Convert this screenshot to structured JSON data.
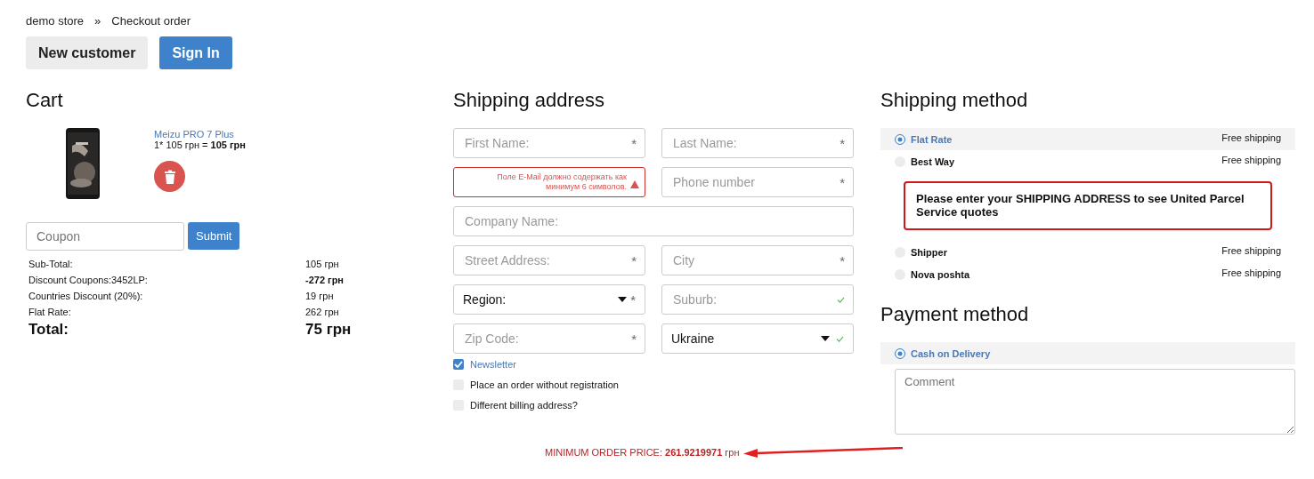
{
  "breadcrumb": [
    {
      "label": "demo store"
    },
    {
      "label": "Checkout order"
    }
  ],
  "breadcrumb_separator": "»",
  "account_buttons": [
    {
      "label": "New customer",
      "selected": true
    },
    {
      "label": "Sign In",
      "selected": false
    }
  ],
  "cart": {
    "title": "Cart",
    "items": [
      {
        "kind": "picture",
        "name": "Meizu PRO 7 Plus",
        "quantity_price": "1* 105 грн = ",
        "line_total": "105 грн"
      }
    ],
    "coupon": {
      "placeholder": "Coupon",
      "button": "Submit"
    },
    "totals": [
      {
        "label": "Sub-Total:",
        "value": "105 грн",
        "bold": false
      },
      {
        "label": "Discount Coupons:3452LP:",
        "value": "-272 грн",
        "bold": true
      },
      {
        "label": "Countries Discount (20%):",
        "value": "19 грн",
        "bold": false
      },
      {
        "label": "Flat Rate:",
        "value": "262 грн",
        "bold": false
      }
    ],
    "total": {
      "label": "Total:",
      "value": "75 грн"
    }
  },
  "shipping_address": {
    "title": "Shipping address",
    "fields": [
      {
        "kind": "input",
        "placeholder": "First Name:",
        "marker": "*",
        "wide": false,
        "valid": false
      },
      {
        "kind": "input",
        "placeholder": "Last Name:",
        "marker": "*",
        "wide": false,
        "valid": false
      },
      {
        "kind": "error",
        "message": "Поле E-Mail должно содержать как минимум 6 символов.",
        "wide": false,
        "valid": false
      },
      {
        "kind": "input",
        "placeholder": "Phone number",
        "marker": "*",
        "wide": false,
        "valid": false
      },
      {
        "kind": "input",
        "placeholder": "Company Name:",
        "wide": true,
        "valid": false
      },
      {
        "kind": "input",
        "placeholder": "Street Address:",
        "marker": "*",
        "wide": false,
        "valid": false
      },
      {
        "kind": "input",
        "placeholder": "City",
        "marker": "*",
        "wide": false,
        "valid": false
      },
      {
        "kind": "select",
        "value": "Region:",
        "marker": "*",
        "wide": false,
        "valid": false
      },
      {
        "kind": "input",
        "placeholder": "Suburb:",
        "wide": false,
        "valid": true
      },
      {
        "kind": "input",
        "placeholder": "Zip Code:",
        "marker": "*",
        "wide": false,
        "valid": false
      },
      {
        "kind": "select",
        "value": "Ukraine",
        "wide": false,
        "valid": true
      }
    ],
    "options": [
      {
        "label": "Newsletter",
        "checked": true
      },
      {
        "label": "Place an order without registration",
        "checked": false
      },
      {
        "label": "Different billing address?",
        "checked": false
      }
    ]
  },
  "shipping_method": {
    "title": "Shipping method",
    "methods": [
      {
        "kind": "method",
        "name": "Flat Rate",
        "price": "Free shipping",
        "selected": true
      },
      {
        "kind": "method",
        "name": "Best Way",
        "price": "Free shipping",
        "selected": false
      },
      {
        "kind": "notice",
        "text": "Please enter your SHIPPING ADDRESS to see United Parcel Service quotes"
      },
      {
        "kind": "method",
        "name": "Shipper",
        "price": "Free shipping",
        "selected": false
      },
      {
        "kind": "method",
        "name": "Nova poshta",
        "price": "Free shipping",
        "selected": false
      }
    ]
  },
  "payment_method": {
    "title": "Payment method",
    "methods": [
      {
        "name": "Cash on Delivery",
        "selected": true
      }
    ],
    "comment": {
      "placeholder": "Comment"
    }
  },
  "minimum_order": {
    "label": "MINIMUM ORDER PRICE: ",
    "value": "261.9219971",
    "currency": " грн"
  }
}
